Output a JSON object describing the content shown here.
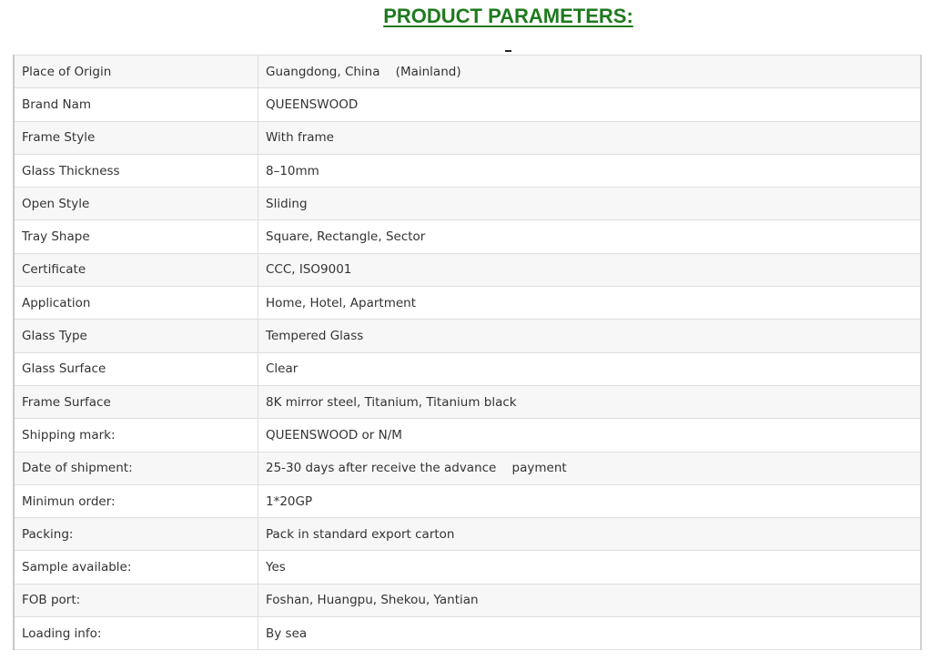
{
  "header": {
    "title": "PRODUCT PARAMETERS:"
  },
  "colors": {
    "title": "#1e7a1e",
    "row_shade": "#f7f7f7",
    "border": "#dedede",
    "text": "#333333"
  },
  "params": [
    {
      "label": "Place of Origin",
      "value": "Guangdong, China    (Mainland)"
    },
    {
      "label": "Brand Nam",
      "value": "QUEENSWOOD"
    },
    {
      "label": "Frame Style",
      "value": "With frame"
    },
    {
      "label": "Glass Thickness",
      "value": "8–10mm"
    },
    {
      "label": "Open Style",
      "value": "Sliding"
    },
    {
      "label": "Tray Shape",
      "value": "Square, Rectangle, Sector"
    },
    {
      "label": "Certificate",
      "value": "CCC, ISO9001"
    },
    {
      "label": "Application",
      "value": "Home, Hotel, Apartment"
    },
    {
      "label": "Glass Type",
      "value": "Tempered Glass"
    },
    {
      "label": "Glass Surface",
      "value": "Clear"
    },
    {
      "label": "Frame Surface",
      "value": "8K mirror steel, Titanium, Titanium black"
    },
    {
      "label": "Shipping mark:",
      "value": "QUEENSWOOD or N/M"
    },
    {
      "label": "Date of shipment:",
      "value": "25-30 days after receive the advance    payment"
    },
    {
      "label": "Minimun order:",
      "value": "1*20GP"
    },
    {
      "label": "Packing:",
      "value": "Pack in standard export carton"
    },
    {
      "label": "Sample available:",
      "value": "Yes"
    },
    {
      "label": "FOB port:",
      "value": "Foshan, Huangpu, Shekou, Yantian"
    },
    {
      "label": "Loading info:",
      "value": "By sea"
    }
  ]
}
